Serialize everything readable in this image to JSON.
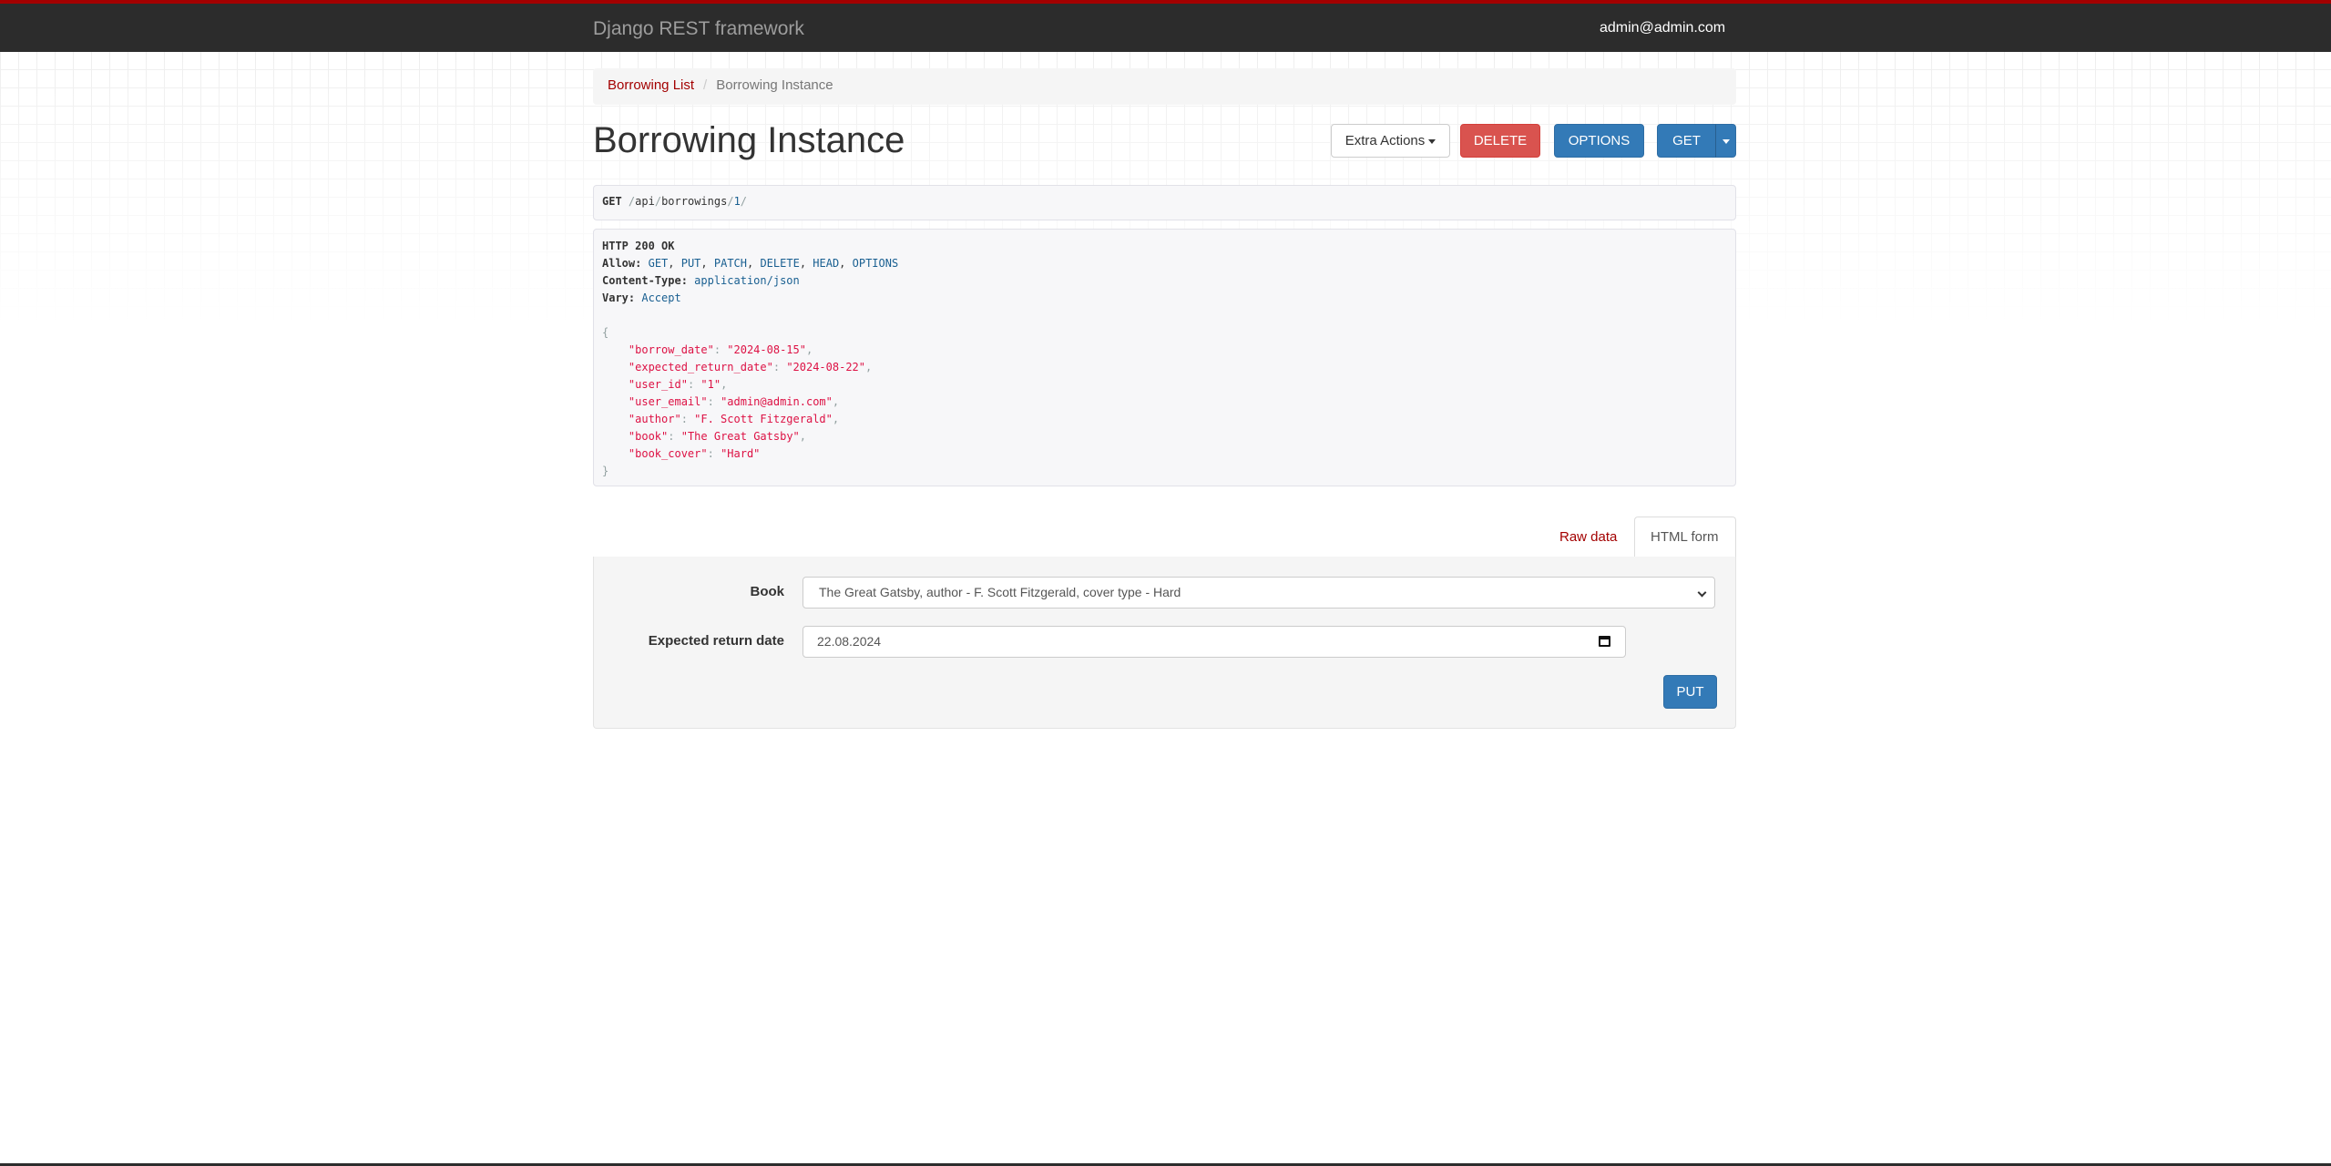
{
  "navbar": {
    "brand": "Django REST framework",
    "user": "admin@admin.com"
  },
  "breadcrumb": {
    "items": [
      {
        "label": "Borrowing List"
      },
      {
        "label": "Borrowing Instance"
      }
    ],
    "separator": "/"
  },
  "page": {
    "title": "Borrowing Instance"
  },
  "actions": {
    "extra": "Extra Actions",
    "delete": "DELETE",
    "options": "OPTIONS",
    "get": "GET"
  },
  "request": {
    "method": "GET",
    "path_parts": [
      "/",
      "api",
      "/",
      "borrowings",
      "/",
      "1",
      "/"
    ]
  },
  "response": {
    "status": "HTTP 200 OK",
    "headers": {
      "allow_key": "Allow:",
      "allow_values": [
        "GET",
        "PUT",
        "PATCH",
        "DELETE",
        "HEAD",
        "OPTIONS"
      ],
      "content_type_key": "Content-Type:",
      "content_type_value": "application/json",
      "vary_key": "Vary:",
      "vary_value": "Accept"
    },
    "body": [
      {
        "key": "\"borrow_date\"",
        "value": "\"2024-08-15\"",
        "comma": ","
      },
      {
        "key": "\"expected_return_date\"",
        "value": "\"2024-08-22\"",
        "comma": ","
      },
      {
        "key": "\"user_id\"",
        "value": "\"1\"",
        "comma": ","
      },
      {
        "key": "\"user_email\"",
        "value": "\"admin@admin.com\"",
        "comma": ","
      },
      {
        "key": "\"author\"",
        "value": "\"F. Scott Fitzgerald\"",
        "comma": ","
      },
      {
        "key": "\"book\"",
        "value": "\"The Great Gatsby\"",
        "comma": ","
      },
      {
        "key": "\"book_cover\"",
        "value": "\"Hard\"",
        "comma": ""
      }
    ],
    "open_brace": "{",
    "close_brace": "}"
  },
  "tabs": {
    "raw": "Raw data",
    "html": "HTML form"
  },
  "form": {
    "book_label": "Book",
    "book_value": "The Great Gatsby, author - F. Scott Fitzgerald, cover type - Hard",
    "return_label": "Expected return date",
    "return_value": "22.08.2024",
    "submit": "PUT"
  },
  "colors": {
    "accent": "#a30000",
    "navbar": "#2c2c2c",
    "primary": "#337ab7",
    "danger": "#d9534f"
  }
}
